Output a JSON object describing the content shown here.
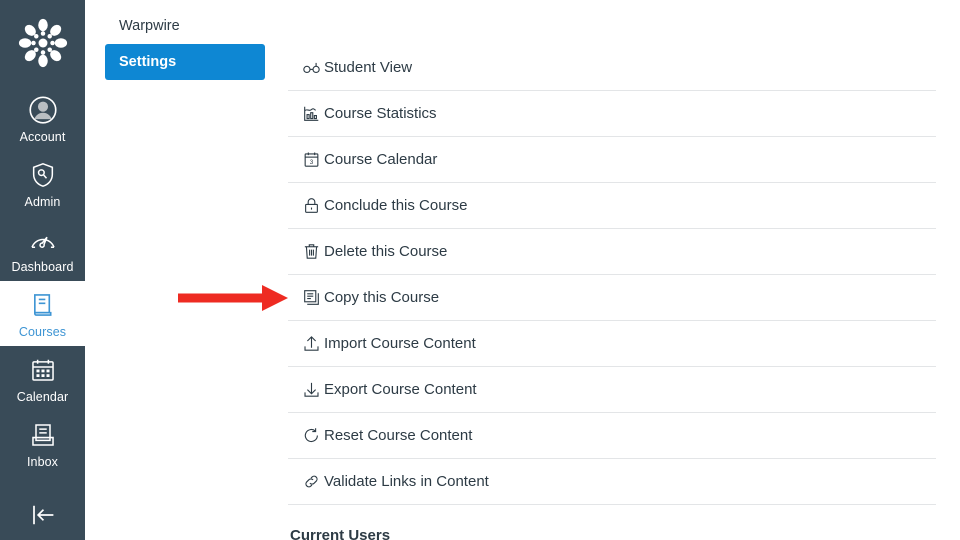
{
  "global_nav": {
    "logo": "canvas-logo",
    "items": [
      {
        "label": "Account",
        "icon": "user-circle-icon",
        "active": false
      },
      {
        "label": "Admin",
        "icon": "shield-wrench-icon",
        "active": false
      },
      {
        "label": "Dashboard",
        "icon": "speedometer-icon",
        "active": false
      },
      {
        "label": "Courses",
        "icon": "book-icon",
        "active": true
      },
      {
        "label": "Calendar",
        "icon": "calendar-icon",
        "active": false
      },
      {
        "label": "Inbox",
        "icon": "inbox-tray-icon",
        "active": false
      }
    ],
    "collapse_icon": "collapse-left-icon",
    "background_color": "#394B58",
    "active_color": "#3E95D4"
  },
  "course_nav": {
    "items": [
      {
        "label": "Warpwire",
        "active": false
      },
      {
        "label": "Settings",
        "active": true
      }
    ],
    "active_color": "#0E87D3"
  },
  "actions": {
    "items": [
      {
        "label": "Student View",
        "icon": "glasses-icon"
      },
      {
        "label": "Course Statistics",
        "icon": "bar-chart-icon"
      },
      {
        "label": "Course Calendar",
        "icon": "calendar-day-icon"
      },
      {
        "label": "Conclude this Course",
        "icon": "lock-icon"
      },
      {
        "label": "Delete this Course",
        "icon": "trash-icon"
      },
      {
        "label": "Copy this Course",
        "icon": "copy-icon"
      },
      {
        "label": "Import Course Content",
        "icon": "upload-icon"
      },
      {
        "label": "Export Course Content",
        "icon": "download-icon"
      },
      {
        "label": "Reset Course Content",
        "icon": "refresh-icon"
      },
      {
        "label": "Validate Links in Content",
        "icon": "link-icon"
      }
    ]
  },
  "current_users_heading": "Current Users",
  "annotation": {
    "type": "arrow",
    "points_to": "Copy this Course",
    "color": "#EE2B22"
  }
}
